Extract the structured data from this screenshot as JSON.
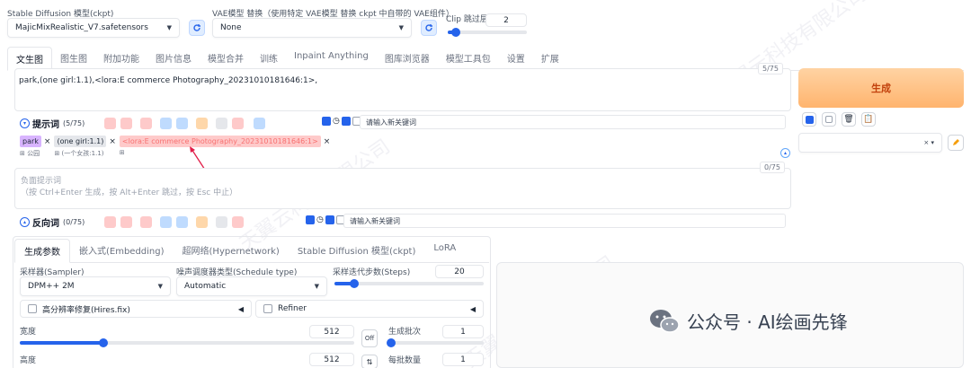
{
  "top": {
    "model_label": "Stable Diffusion 模型(ckpt)",
    "model_value": "MajicMixRealistic_V7.safetensors",
    "vae_label": "VAE模型 替换（使用特定 VAE模型 替换 ckpt 中自带的 VAE组件）",
    "vae_value": "None",
    "clip_label": "Clip 跳过层",
    "clip_value": "2",
    "clip_fraction": 0.1
  },
  "tabs": [
    "文生图",
    "图生图",
    "附加功能",
    "图片信息",
    "模型合并",
    "训练",
    "Inpaint Anything",
    "图库浏览器",
    "模型工具包",
    "设置",
    "扩展"
  ],
  "prompt": {
    "text": "park,(one girl:1.1),<lora:E commerce Photography_20231010181646:1>,",
    "counter": "5/75",
    "title": "提示词",
    "count": "(5/75)",
    "keyword_placeholder": "请输入新关键词"
  },
  "tags": [
    {
      "text": "park",
      "sub": "公园",
      "color": "#d8b4fe"
    },
    {
      "text": "(one girl:1.1)",
      "sub": "(一个女孩:1.1)",
      "color": "#e5e7eb"
    },
    {
      "text": "<lora:E commerce Photography_20231010181646:1>",
      "sub": "",
      "color": "#fecaca"
    }
  ],
  "negative": {
    "placeholder_line1": "负面提示词",
    "placeholder_line2": "（按 Ctrl+Enter 生成，按 Alt+Enter 跳过，按 Esc 中止）",
    "counter": "0/75",
    "title": "反向词",
    "count": "(0/75)",
    "keyword_placeholder": "请输入新关键词"
  },
  "generate": {
    "label": "生成",
    "style_dropdown": "× ▾"
  },
  "params_tabs": [
    "生成参数",
    "嵌入式(Embedding)",
    "超网络(Hypernetwork)",
    "Stable Diffusion 模型(ckpt)",
    "LoRA"
  ],
  "params": {
    "sampler_label": "采样器(Sampler)",
    "sampler_value": "DPM++ 2M",
    "schedule_label": "噪声调度器类型(Schedule type)",
    "schedule_value": "Automatic",
    "steps_label": "采样迭代步数(Steps)",
    "steps_value": "20",
    "steps_fraction": 0.13,
    "hires_label": "高分辨率修复(Hires.fix)",
    "refiner_label": "Refiner",
    "width_label": "宽度",
    "width_value": "512",
    "width_fraction": 0.25,
    "height_label": "高度",
    "height_value": "512",
    "swap_label": "Off",
    "batch_count_label": "生成批次",
    "batch_count_value": "1",
    "batch_size_label": "每批数量",
    "batch_size_value": "1"
  },
  "watermark": "公众号 · AI绘画先锋"
}
